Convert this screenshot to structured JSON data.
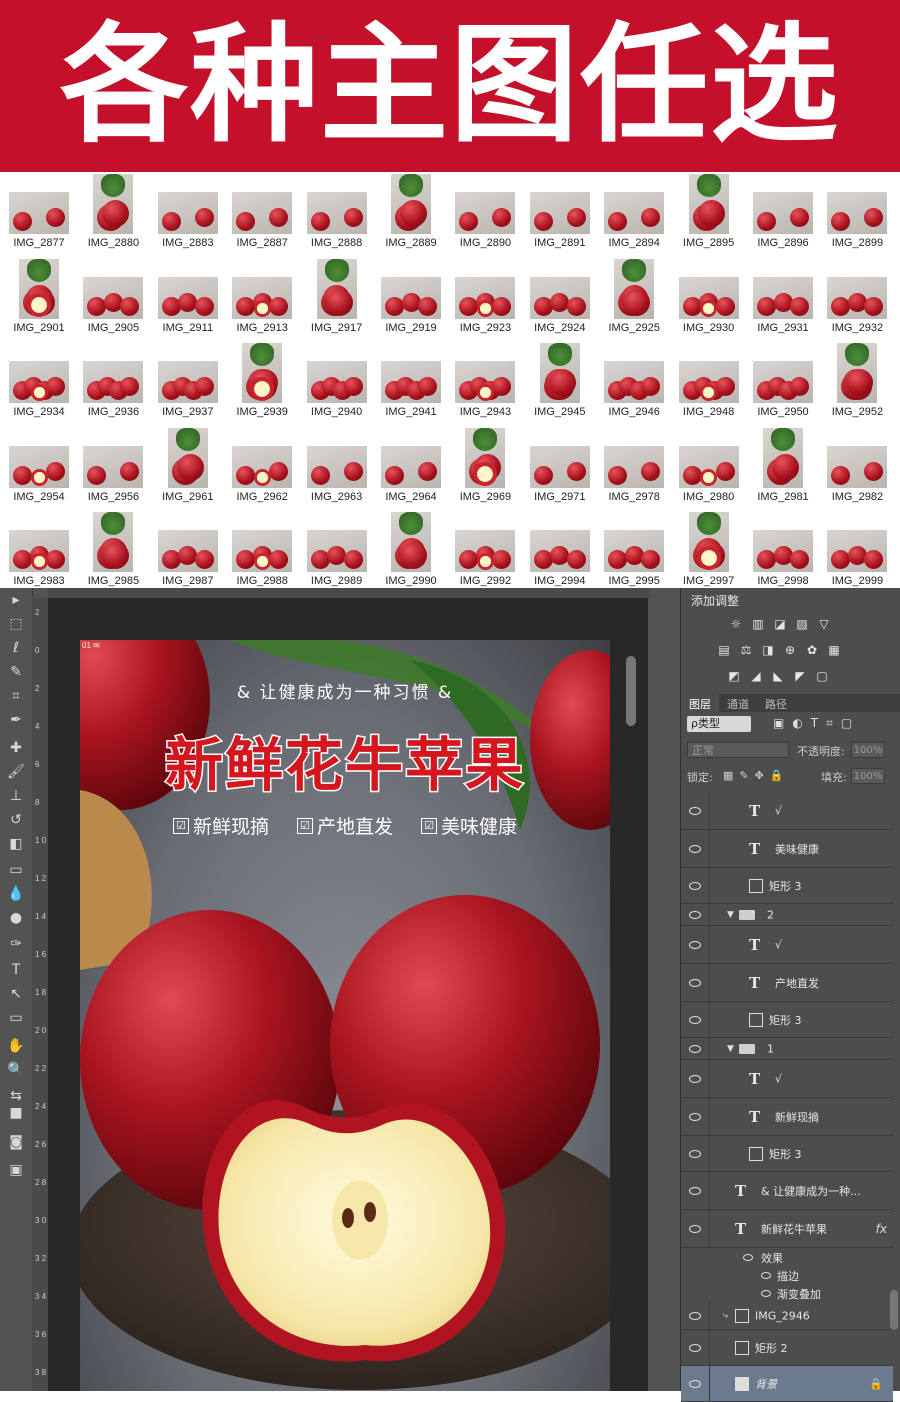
{
  "banner": {
    "title": "各种主图任选"
  },
  "thumbnails": [
    [
      "IMG_2877",
      "IMG_2880",
      "IMG_2883",
      "IMG_2887",
      "IMG_2888",
      "IMG_2889",
      "IMG_2890",
      "IMG_2891",
      "IMG_2894",
      "IMG_2895",
      "IMG_2896",
      "IMG_2899"
    ],
    [
      "IMG_2901",
      "IMG_2905",
      "IMG_2911",
      "IMG_2913",
      "IMG_2917",
      "IMG_2919",
      "IMG_2923",
      "IMG_2924",
      "IMG_2925",
      "IMG_2930",
      "IMG_2931",
      "IMG_2932"
    ],
    [
      "IMG_2934",
      "IMG_2936",
      "IMG_2937",
      "IMG_2939",
      "IMG_2940",
      "IMG_2941",
      "IMG_2943",
      "IMG_2945",
      "IMG_2946",
      "IMG_2948",
      "IMG_2950",
      "IMG_2952"
    ],
    [
      "IMG_2954",
      "IMG_2956",
      "IMG_2961",
      "IMG_2962",
      "IMG_2963",
      "IMG_2964",
      "IMG_2969",
      "IMG_2971",
      "IMG_2978",
      "IMG_2980",
      "IMG_2981",
      "IMG_2982"
    ],
    [
      "IMG_2983",
      "IMG_2985",
      "IMG_2987",
      "IMG_2988",
      "IMG_2989",
      "IMG_2990",
      "IMG_2992",
      "IMG_2994",
      "IMG_2995",
      "IMG_2997",
      "IMG_2998",
      "IMG_2999"
    ]
  ],
  "ruler_labels": [
    "2",
    "0",
    "2",
    "4",
    "6",
    "8",
    "1 0",
    "1 2",
    "1 4",
    "1 6",
    "1 8",
    "2 0",
    "2 2",
    "2 4",
    "2 6",
    "2 8",
    "3 0",
    "3 2",
    "3 4",
    "3 6",
    "3 8"
  ],
  "document": {
    "tag": "01 ✉",
    "subtitle": "& 让健康成为一种习惯 &",
    "title": "新鲜花牛苹果",
    "features": [
      "新鲜现摘",
      "产地直发",
      "美味健康"
    ],
    "check_glyph": "☑"
  },
  "panel": {
    "adjust_title": "添加调整",
    "tabs": [
      "图层",
      "通道",
      "路径"
    ],
    "filter_label": "ρ类型",
    "blend_mode": "正常",
    "opacity_label": "不透明度:",
    "opacity_value": "100%",
    "lock_label": "锁定:",
    "fill_label": "填充:",
    "fill_value": "100%"
  },
  "layers": [
    {
      "kind": "text",
      "name": "√",
      "indent": 2
    },
    {
      "kind": "text",
      "name": "美味健康",
      "indent": 2
    },
    {
      "kind": "shape",
      "name": "矩形 3",
      "indent": 2
    },
    {
      "kind": "group",
      "name": "2",
      "indent": 1
    },
    {
      "kind": "text",
      "name": "√",
      "indent": 2
    },
    {
      "kind": "text",
      "name": "产地直发",
      "indent": 2
    },
    {
      "kind": "shape",
      "name": "矩形 3",
      "indent": 2
    },
    {
      "kind": "group",
      "name": "1",
      "indent": 1
    },
    {
      "kind": "text",
      "name": "√",
      "indent": 2
    },
    {
      "kind": "text",
      "name": "新鲜现摘",
      "indent": 2
    },
    {
      "kind": "shape",
      "name": "矩形 3",
      "indent": 2
    },
    {
      "kind": "text",
      "name": "& 让健康成为一种...",
      "indent": 1
    },
    {
      "kind": "text",
      "name": "新鲜花牛苹果",
      "indent": 1,
      "fx": "fx"
    },
    {
      "kind": "effects",
      "name": "效果",
      "items": [
        "描边",
        "渐变叠加"
      ]
    },
    {
      "kind": "smart",
      "name": "IMG_2946",
      "indent": 1
    },
    {
      "kind": "shape",
      "name": "矩形 2",
      "indent": 1
    },
    {
      "kind": "background",
      "name": "背景",
      "indent": 1
    }
  ],
  "colors": {
    "banner": "#c4102a",
    "title_red": "#d4161e",
    "ps_bg": "#535353",
    "panel_bg": "#4d4d4d"
  }
}
